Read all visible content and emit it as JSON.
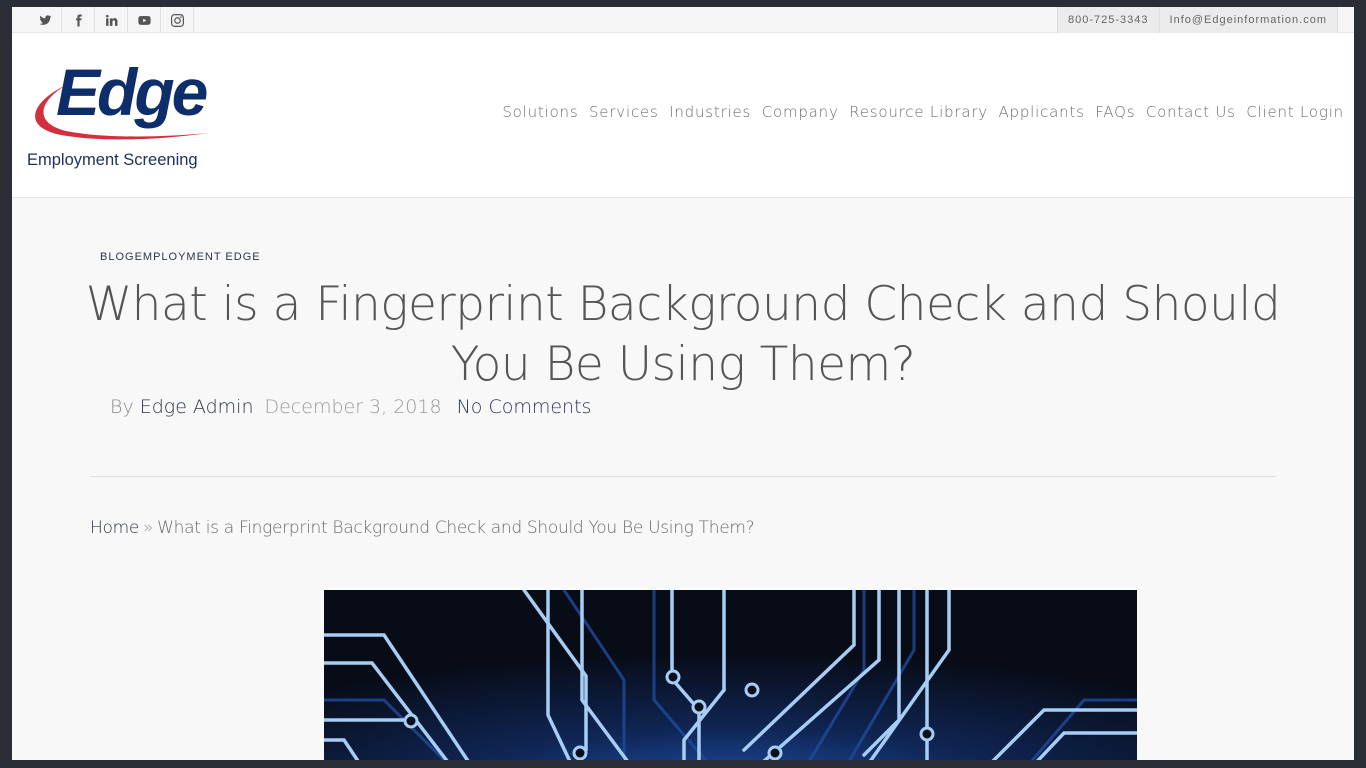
{
  "topbar": {
    "social": [
      {
        "name": "twitter",
        "icon": "twitter-icon"
      },
      {
        "name": "facebook",
        "icon": "facebook-icon"
      },
      {
        "name": "linkedin",
        "icon": "linkedin-icon"
      },
      {
        "name": "youtube",
        "icon": "youtube-icon"
      },
      {
        "name": "instagram",
        "icon": "instagram-icon"
      }
    ],
    "phone": "800-725-3343",
    "email": "Info@Edgeinformation.com"
  },
  "logo": {
    "word": "Edge",
    "tagline": "Employment Screening",
    "colors": {
      "navy": "#0e2e6b",
      "red": "#d2303f"
    }
  },
  "nav": {
    "items": [
      "Solutions",
      "Services",
      "Industries",
      "Company",
      "Resource Library",
      "Applicants",
      "FAQs",
      "Contact Us",
      "Client Login"
    ]
  },
  "article": {
    "categories": "BLOGEMPLOYMENT EDGE",
    "title": "What is a Fingerprint Background Check and Should You Be Using Them?",
    "by_label": "By",
    "author": "Edge Admin",
    "date": "December 3, 2018",
    "comments": "No Comments"
  },
  "breadcrumb": {
    "home": "Home",
    "separator": "»",
    "current": "What is a Fingerprint Background Check and Should You Be Using Them?"
  },
  "hero": {
    "icon": "circuit-board-image",
    "colors": {
      "background": "#0a0f1c",
      "trace": "#a8cdf5",
      "glow": "#1e4fa8"
    }
  }
}
